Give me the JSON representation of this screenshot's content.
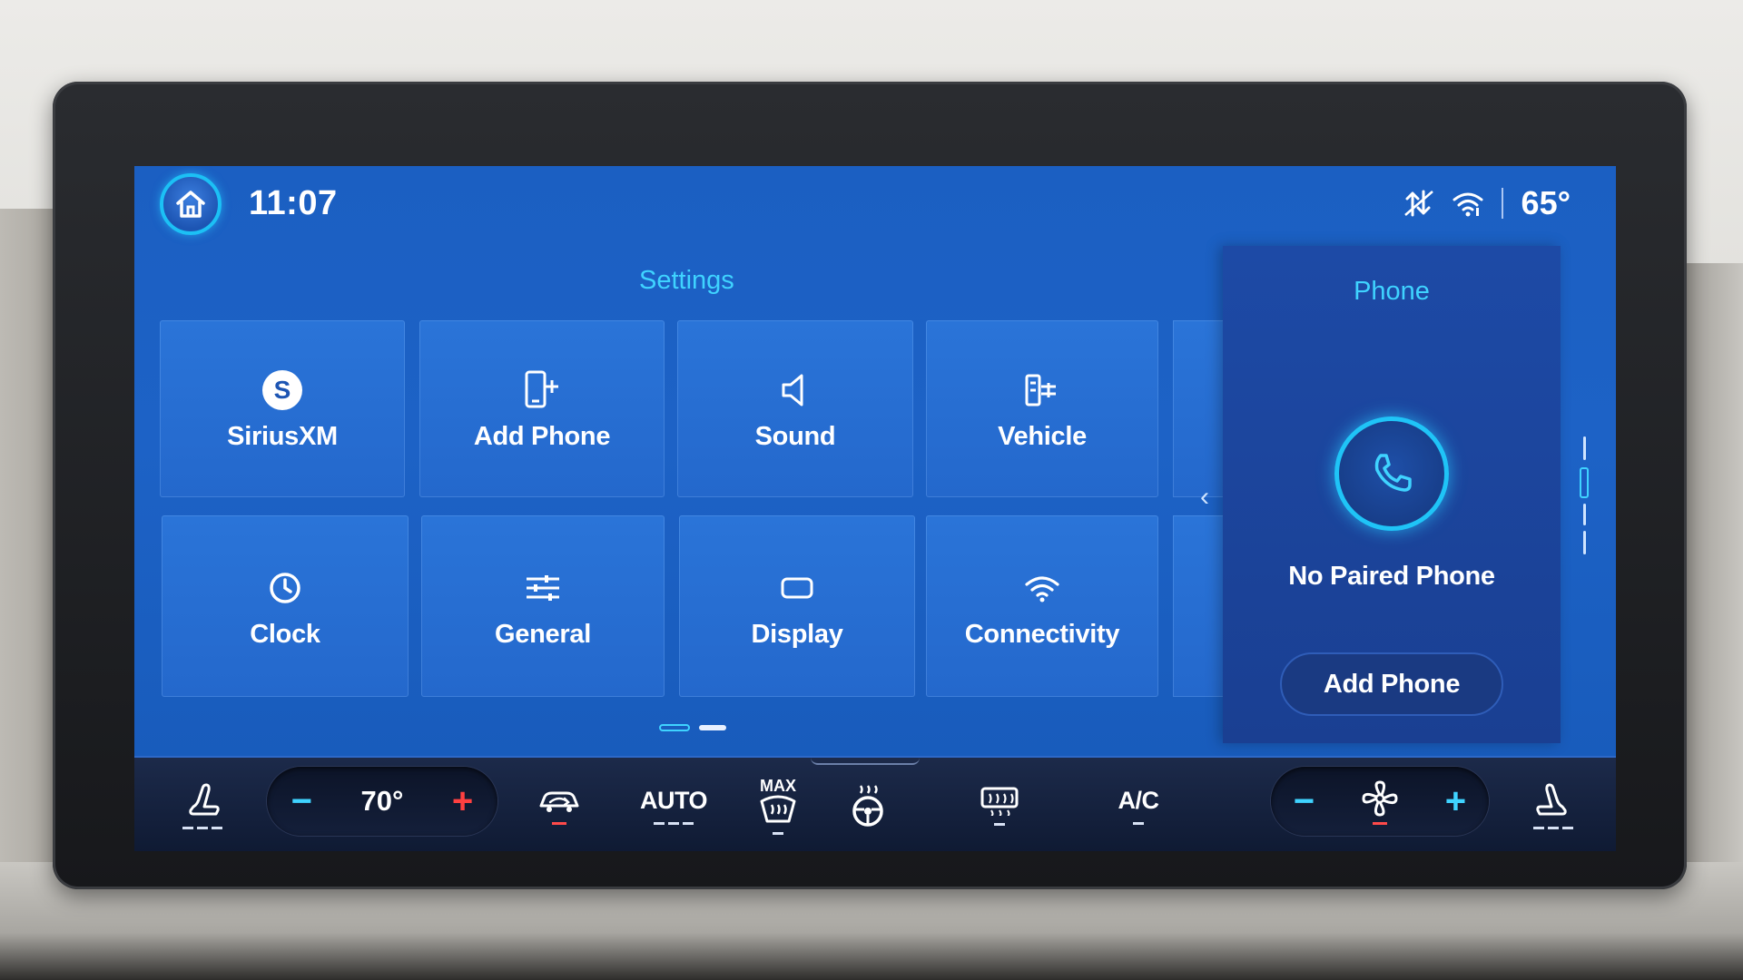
{
  "status": {
    "time": "11:07",
    "outside_temp": "65°"
  },
  "settings": {
    "title": "Settings",
    "tiles": [
      {
        "label": "SiriusXM",
        "icon": "siriusxm-icon"
      },
      {
        "label": "Add Phone",
        "icon": "add-phone-icon"
      },
      {
        "label": "Sound",
        "icon": "speaker-icon"
      },
      {
        "label": "Vehicle",
        "icon": "vehicle-settings-icon"
      },
      {
        "label": "Clock",
        "icon": "clock-icon"
      },
      {
        "label": "General",
        "icon": "sliders-icon"
      },
      {
        "label": "Display",
        "icon": "display-icon"
      },
      {
        "label": "Connectivity",
        "icon": "wifi-icon"
      }
    ],
    "page_index": 1,
    "page_count": 2
  },
  "phone_panel": {
    "title": "Phone",
    "status": "No Paired Phone",
    "button_label": "Add Phone"
  },
  "climate": {
    "set_temp": "70°",
    "auto_label": "AUTO",
    "max_label": "MAX",
    "ac_label": "A/C"
  },
  "colors": {
    "screen_blue": "#1d62c6",
    "accent_cyan": "#3fd3ff",
    "heat_red": "#ff4040",
    "climate_bar": "#0f1a33"
  }
}
